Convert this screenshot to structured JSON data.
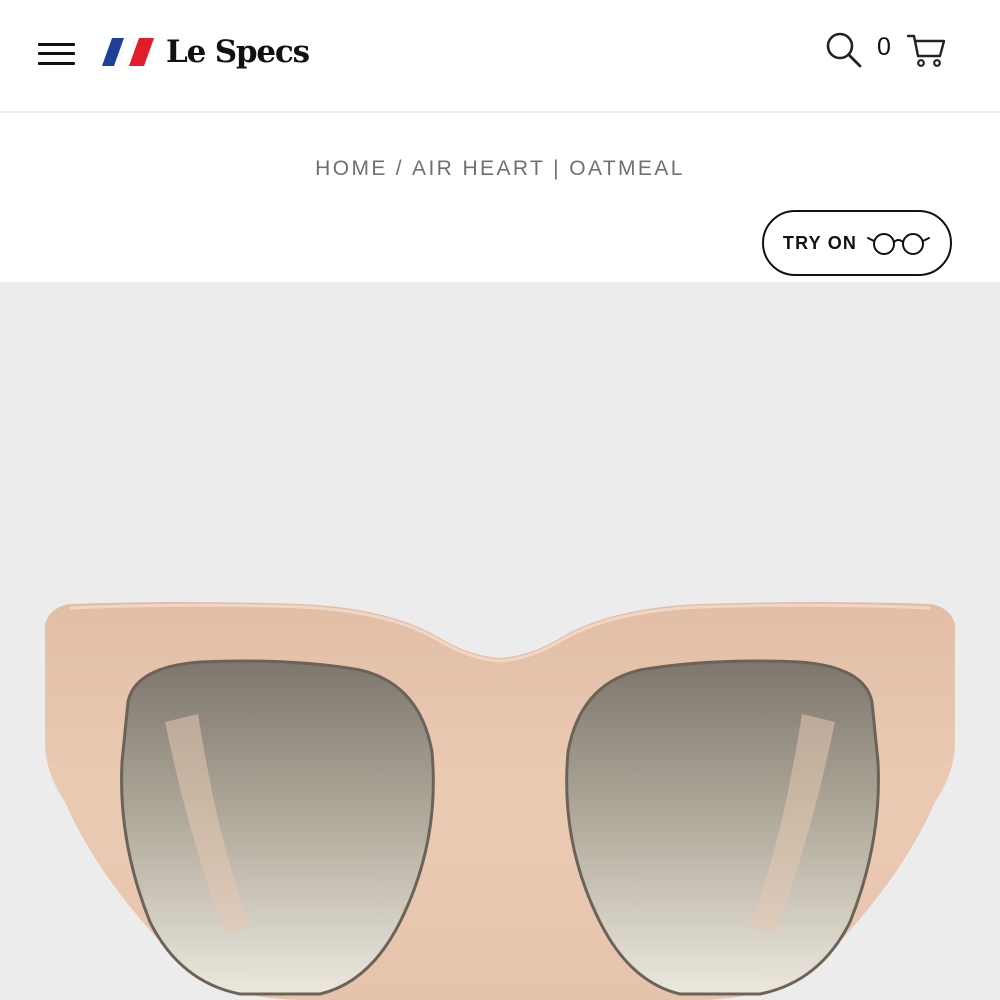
{
  "header": {
    "brand": "Le Specs",
    "cart_count": "0",
    "icons": {
      "menu": "hamburger-menu-icon",
      "logo_mark": "tricolor-stripes-icon",
      "search": "magnifier-icon",
      "cart": "shopping-cart-icon"
    },
    "colors": {
      "logo_blue": "#1f3f99",
      "logo_red": "#e21c2a"
    }
  },
  "breadcrumb": {
    "home": "HOME",
    "separator": "/",
    "current": "AIR HEART | OATMEAL"
  },
  "try_on": {
    "label": "TRY ON",
    "icon": "eyeglasses-icon"
  },
  "product": {
    "frame_color": "#e8c7b0",
    "lens_tint_top": "#7d766c",
    "lens_tint_bottom": "#ece8de",
    "background": "#ececec"
  }
}
